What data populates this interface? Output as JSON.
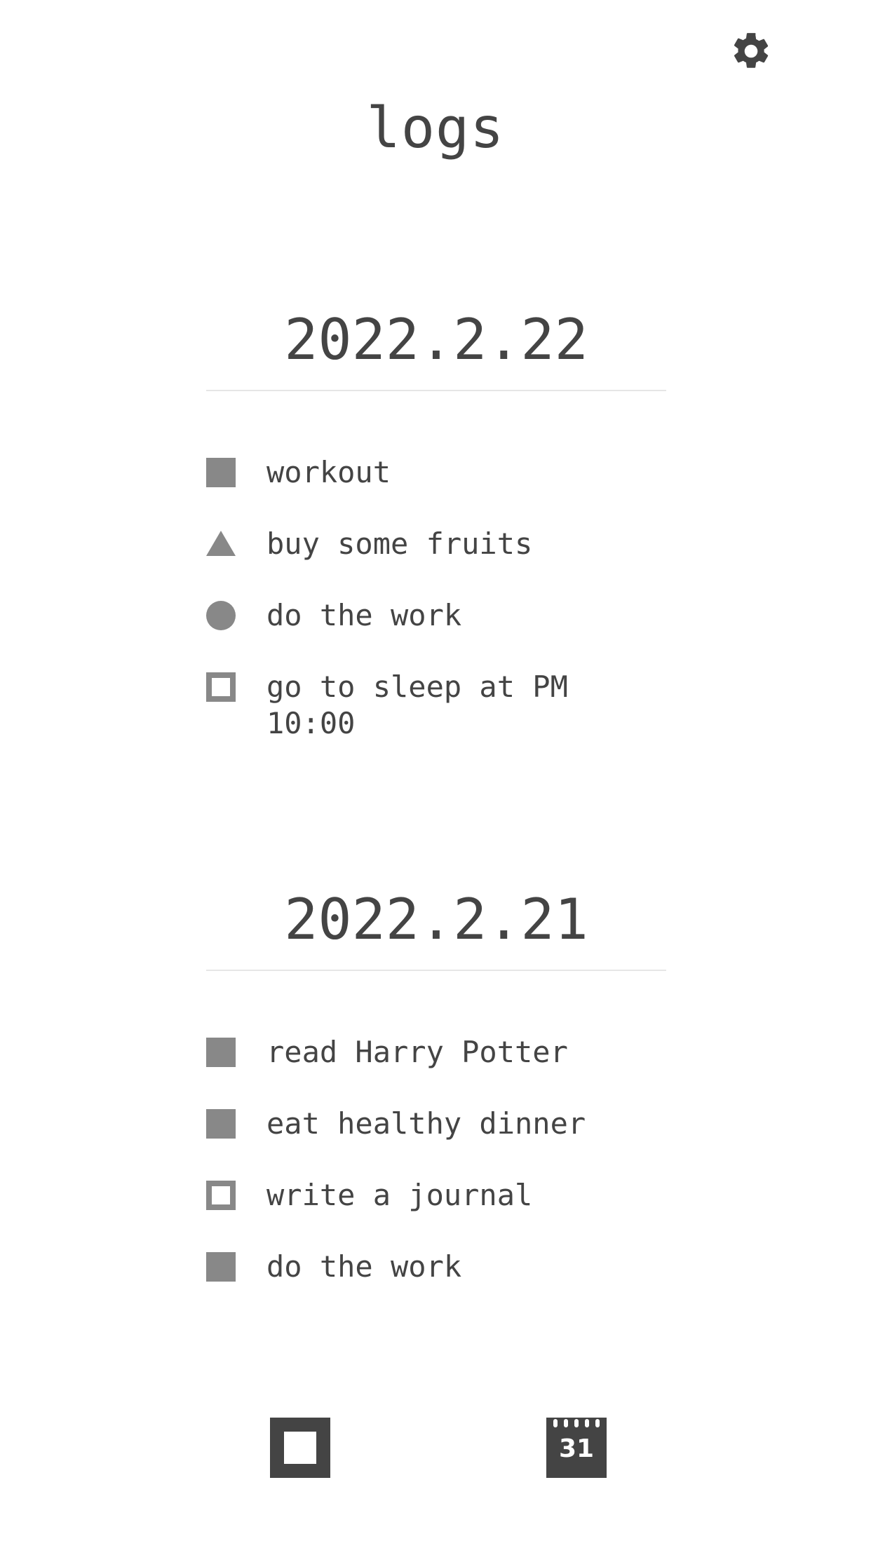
{
  "header": {
    "title": "logs",
    "settings_icon": "gear-icon"
  },
  "logs": [
    {
      "date": "2022.2.22",
      "entries": [
        {
          "bullet": "filled-square",
          "text": "workout"
        },
        {
          "bullet": "triangle",
          "text": "buy some fruits"
        },
        {
          "bullet": "circle",
          "text": "do the work"
        },
        {
          "bullet": "hollow-square",
          "text": "go to sleep at PM 10:00"
        }
      ]
    },
    {
      "date": "2022.2.21",
      "entries": [
        {
          "bullet": "filled-square",
          "text": "read Harry Potter"
        },
        {
          "bullet": "filled-square",
          "text": "eat healthy dinner"
        },
        {
          "bullet": "hollow-square",
          "text": "write a journal"
        },
        {
          "bullet": "filled-square",
          "text": "do the work"
        }
      ]
    }
  ],
  "toolbar": {
    "new_entry_icon": "square-outline-icon",
    "calendar_icon": "calendar-icon",
    "calendar_day": "31"
  },
  "colors": {
    "text": "#444444",
    "bullet": "#888888",
    "divider": "#e6e6e6",
    "background": "#ffffff"
  }
}
